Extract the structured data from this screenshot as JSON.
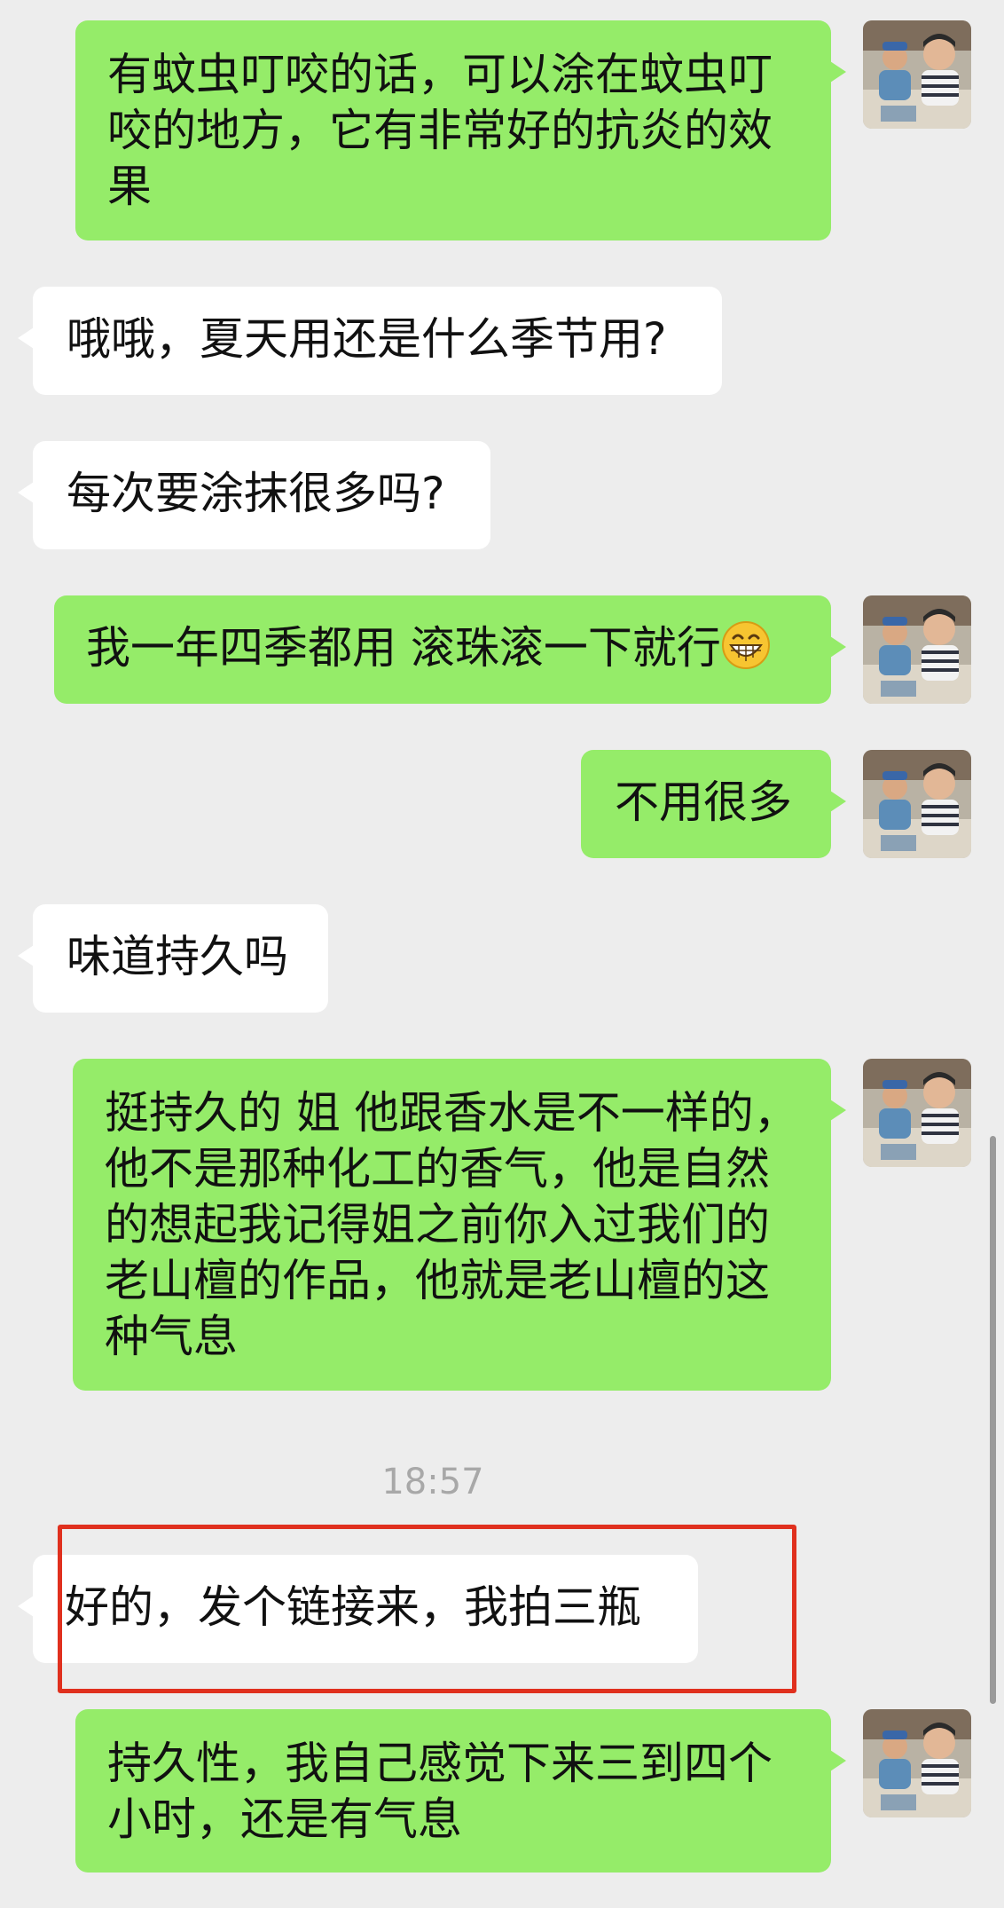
{
  "conversation": {
    "messages": [
      {
        "sender": "me",
        "text": "有蚊虫叮咬的话，可以涂在蚊虫叮咬的地方，它有非常好的抗炎的效果"
      },
      {
        "sender": "other",
        "text": "哦哦，夏天用还是什么季节用?"
      },
      {
        "sender": "other",
        "text": "每次要涂抹很多吗?"
      },
      {
        "sender": "me",
        "text": "我一年四季都用 滚珠滚一下就行",
        "emoji": "grinning-face-emoji"
      },
      {
        "sender": "me",
        "text": "不用很多"
      },
      {
        "sender": "other",
        "text": "味道持久吗"
      },
      {
        "sender": "me",
        "text": "挺持久的 姐 他跟香水是不一样的，他不是那种化工的香气，他是自然的想起我记得姐之前你入过我们的老山檀的作品，他就是老山檀的这种气息"
      },
      {
        "sender": "other",
        "text": "好的，发个链接来，我拍三瓶",
        "highlighted": true
      },
      {
        "sender": "me",
        "text": "持久性，我自己感觉下来三到四个小时，还是有气息"
      }
    ],
    "timestamp": "18:57"
  },
  "colors": {
    "background": "#ededed",
    "my_bubble": "#95ec69",
    "other_bubble": "#ffffff",
    "highlight_border": "#e0301e",
    "timestamp_text": "#a8a8a8"
  },
  "icons": {
    "avatar": "user-avatar-photo",
    "emoji": "grinning-face-emoji"
  }
}
